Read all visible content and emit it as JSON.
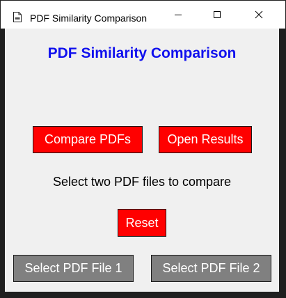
{
  "window": {
    "title": "PDF Similarity Comparison",
    "icon": "pdf-file-icon"
  },
  "controls": {
    "minimize_icon": "minimize-icon",
    "maximize_icon": "maximize-icon",
    "close_icon": "close-icon"
  },
  "main": {
    "heading": "PDF Similarity Comparison",
    "compare_label": "Compare PDFs",
    "open_results_label": "Open Results",
    "status": "Select two PDF files to compare",
    "reset_label": "Reset",
    "select_file1_label": "Select PDF File 1",
    "select_file2_label": "Select PDF File 2"
  },
  "colors": {
    "heading": "#1111ee",
    "action_button": "#ff0000",
    "file_button": "#808080",
    "button_text": "#ffffff",
    "background": "#f0f0f0"
  }
}
